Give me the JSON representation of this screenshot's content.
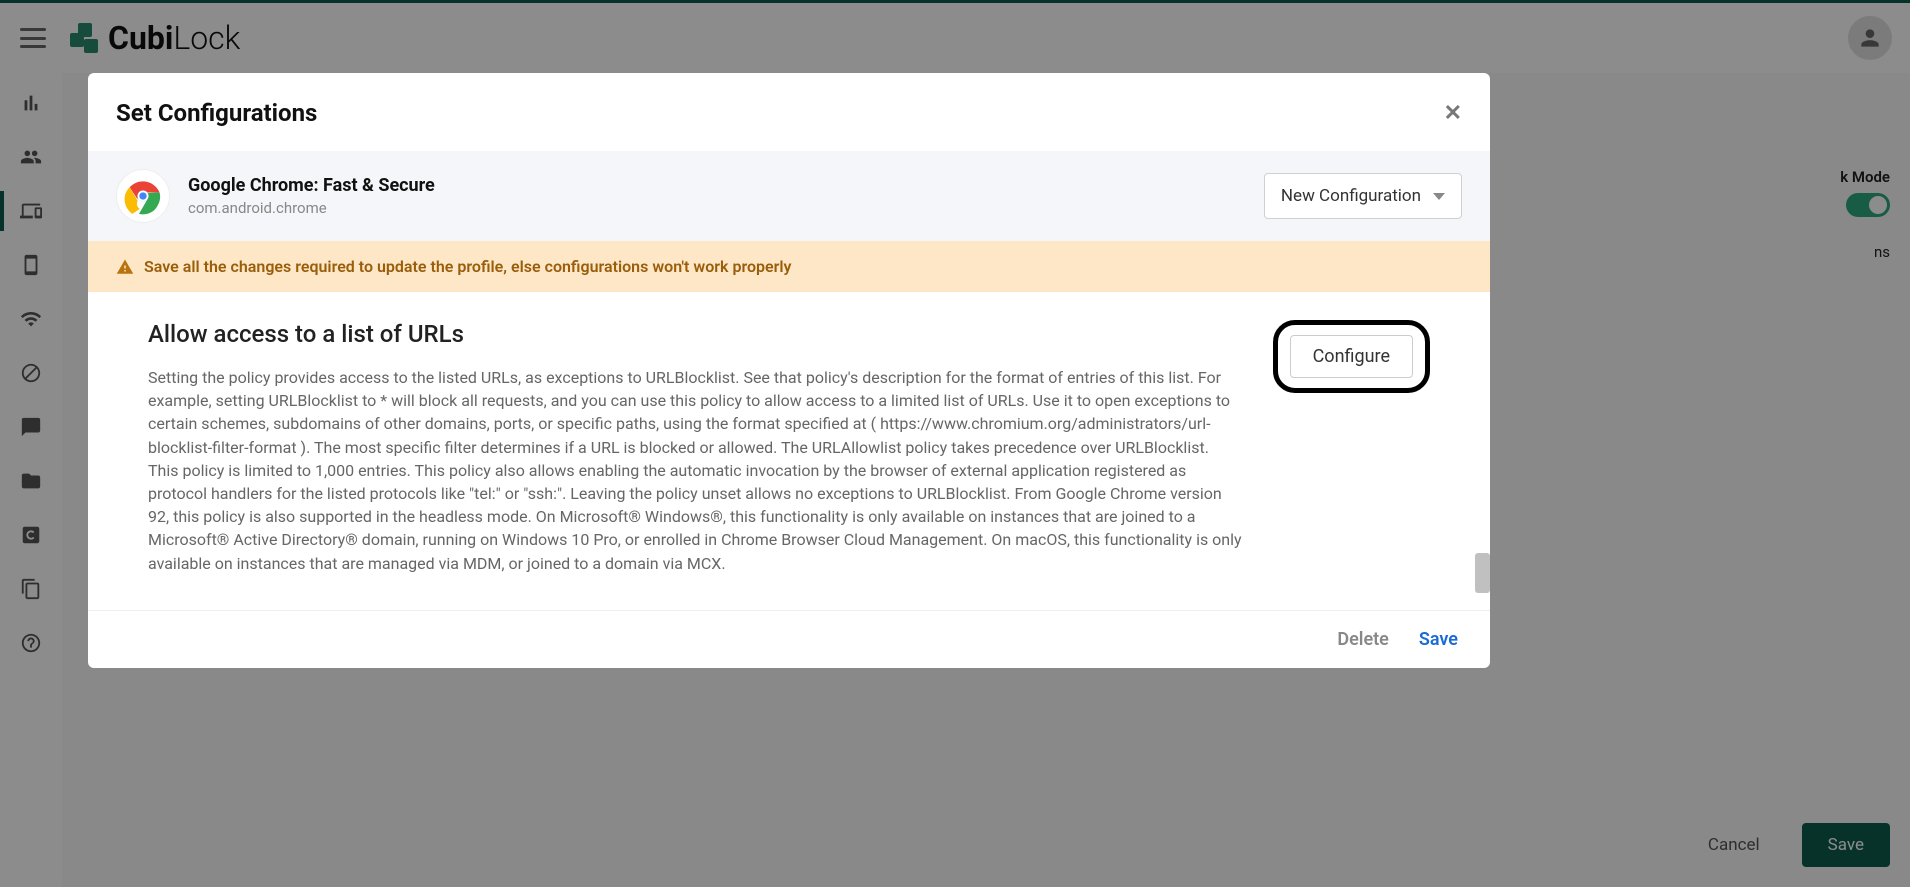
{
  "header": {
    "logo_bold": "Cubi",
    "logo_light": "Lock"
  },
  "bg": {
    "mode_label": "k Mode",
    "ns_label": "ns",
    "cancel": "Cancel",
    "save": "Save"
  },
  "modal": {
    "title": "Set Configurations",
    "app_name": "Google Chrome: Fast & Secure",
    "app_pkg": "com.android.chrome",
    "config_select": "New Configuration",
    "warning": "Save all the changes required to update the profile, else configurations won't work properly",
    "policy_title": "Allow access to a list of URLs",
    "policy_desc": "Setting the policy provides access to the listed URLs, as exceptions to URLBlocklist. See that policy's description for the format of entries of this list. For example, setting URLBlocklist to * will block all requests, and you can use this policy to allow access to a limited list of URLs. Use it to open exceptions to certain schemes, subdomains of other domains, ports, or specific paths, using the format specified at ( https://www.chromium.org/administrators/url-blocklist-filter-format ). The most specific filter determines if a URL is blocked or allowed. The URLAllowlist policy takes precedence over URLBlocklist. This policy is limited to 1,000 entries. This policy also allows enabling the automatic invocation by the browser of external application registered as protocol handlers for the listed protocols like \"tel:\" or \"ssh:\". Leaving the policy unset allows no exceptions to URLBlocklist. From Google Chrome version 92, this policy is also supported in the headless mode. On Microsoft® Windows®, this functionality is only available on instances that are joined to a Microsoft® Active Directory® domain, running on Windows 10 Pro, or enrolled in Chrome Browser Cloud Management. On macOS, this functionality is only available on instances that are managed via MDM, or joined to a domain via MCX.",
    "configure_btn": "Configure",
    "delete_btn": "Delete",
    "save_btn": "Save"
  }
}
